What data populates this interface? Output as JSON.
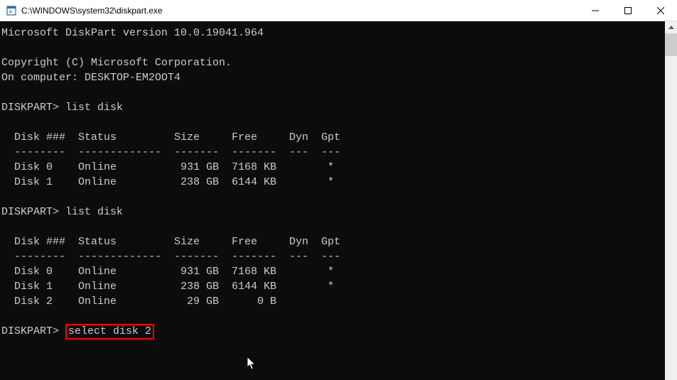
{
  "title": "C:\\WINDOWS\\system32\\diskpart.exe",
  "header": {
    "version_line": "Microsoft DiskPart version 10.0.19041.964",
    "copyright": "Copyright (C) Microsoft Corporation.",
    "computer": "On computer: DESKTOP-EM2OOT4"
  },
  "prompt": "DISKPART>",
  "commands": {
    "cmd1": "list disk",
    "cmd2": "list disk",
    "cmd3": "select disk 2"
  },
  "table_header": {
    "col1": "Disk ###",
    "col2": "Status",
    "col3": "Size",
    "col4": "Free",
    "col5": "Dyn",
    "col6": "Gpt"
  },
  "dashes": {
    "col1": "--------",
    "col2": "-------------",
    "col3": "-------",
    "col4": "-------",
    "col5": "---",
    "col6": "---"
  },
  "list1": [
    {
      "disk": "Disk 0",
      "status": "Online",
      "size": "931 GB",
      "free": "7168 KB",
      "dyn": "",
      "gpt": "*"
    },
    {
      "disk": "Disk 1",
      "status": "Online",
      "size": "238 GB",
      "free": "6144 KB",
      "dyn": "",
      "gpt": "*"
    }
  ],
  "list2": [
    {
      "disk": "Disk 0",
      "status": "Online",
      "size": "931 GB",
      "free": "7168 KB",
      "dyn": "",
      "gpt": "*"
    },
    {
      "disk": "Disk 1",
      "status": "Online",
      "size": "238 GB",
      "free": "6144 KB",
      "dyn": "",
      "gpt": "*"
    },
    {
      "disk": "Disk 2",
      "status": "Online",
      "size": "29 GB",
      "free": "0 B",
      "dyn": "",
      "gpt": ""
    }
  ]
}
